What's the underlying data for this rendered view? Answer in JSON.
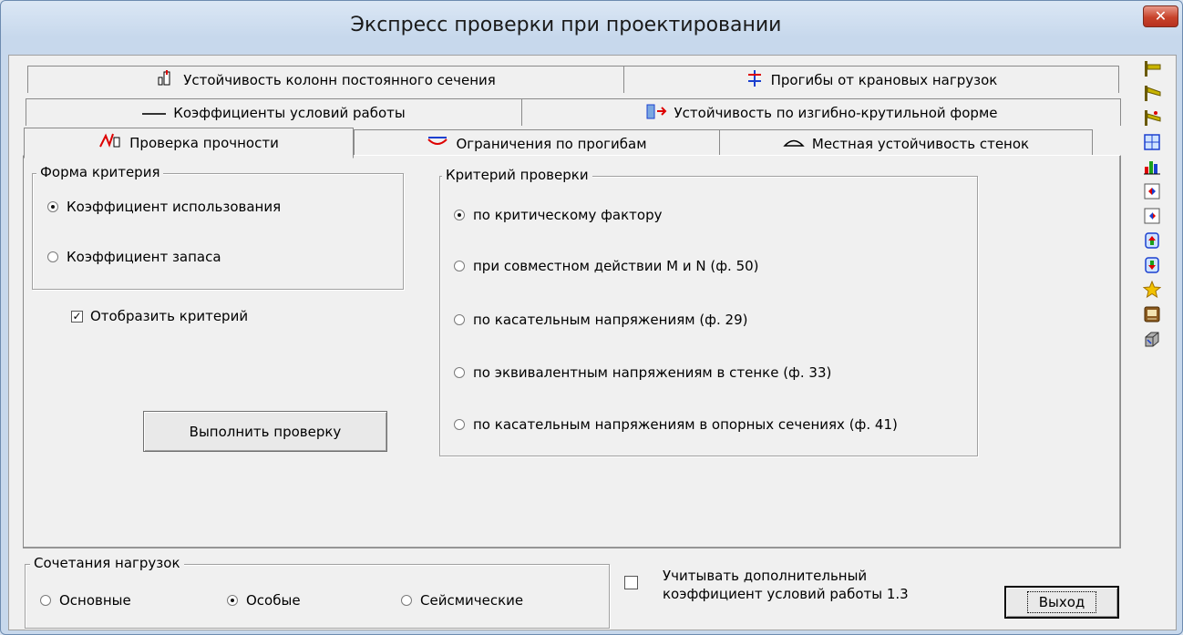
{
  "window": {
    "title": "Экспресс проверки при проектировании",
    "close_glyph": "✕"
  },
  "tabs": {
    "row1": [
      {
        "label": "Устойчивость колонн постоянного сечения",
        "icon": "column-stability-icon"
      },
      {
        "label": "Прогибы от крановых нагрузок",
        "icon": "crane-deflection-icon"
      }
    ],
    "row2": [
      {
        "label": "Коэффициенты условий работы",
        "icon": "line-icon"
      },
      {
        "label": "Устойчивость по изгибно-крутильной форме",
        "icon": "torsion-icon"
      }
    ],
    "row3": [
      {
        "label": "Проверка прочности",
        "icon": "strength-icon",
        "active": true
      },
      {
        "label": "Ограничения по прогибам",
        "icon": "deflection-icon"
      },
      {
        "label": "Местная устойчивость стенок",
        "icon": "web-stability-icon"
      }
    ]
  },
  "criterion_form": {
    "legend": "Форма критерия",
    "options": [
      {
        "label": "Коэффициент использования",
        "selected": true
      },
      {
        "label": "Коэффициент запаса",
        "selected": false
      }
    ]
  },
  "show_criterion": {
    "label": "Отобразить критерий",
    "checked": true,
    "mark": "✓"
  },
  "run_button": {
    "label": "Выполнить проверку"
  },
  "check_criterion": {
    "legend": "Критерий проверки",
    "options": [
      {
        "label": "по критическому фактору",
        "selected": true
      },
      {
        "label": "при совместном действии M и N (ф. 50)",
        "selected": false
      },
      {
        "label": "по касательным напряжениям  (ф. 29)",
        "selected": false
      },
      {
        "label": "по эквивалентным напряжениям в стенке (ф. 33)",
        "selected": false
      },
      {
        "label": "по касательным напряжениям в опорных сечениях (ф. 41)",
        "selected": false
      }
    ]
  },
  "load_combinations": {
    "legend": "Сочетания нагрузок",
    "options": [
      {
        "label": "Основные",
        "selected": false
      },
      {
        "label": "Особые",
        "selected": true
      },
      {
        "label": "Сейсмические",
        "selected": false
      }
    ]
  },
  "extra_coefficient": {
    "line1": "Учитывать дополнительный",
    "line2": "коэффициент условий работы 1.3",
    "checked": false
  },
  "exit_button": {
    "label": "Выход"
  },
  "toolbar": {
    "buttons": [
      "beam-icon",
      "beam-sloped-icon",
      "beam-load-icon",
      "grid-icon",
      "chart-icon",
      "section-left-icon",
      "section-right-icon",
      "section-up-icon",
      "section-down-icon",
      "star-icon",
      "report-icon",
      "settings-icon"
    ]
  }
}
